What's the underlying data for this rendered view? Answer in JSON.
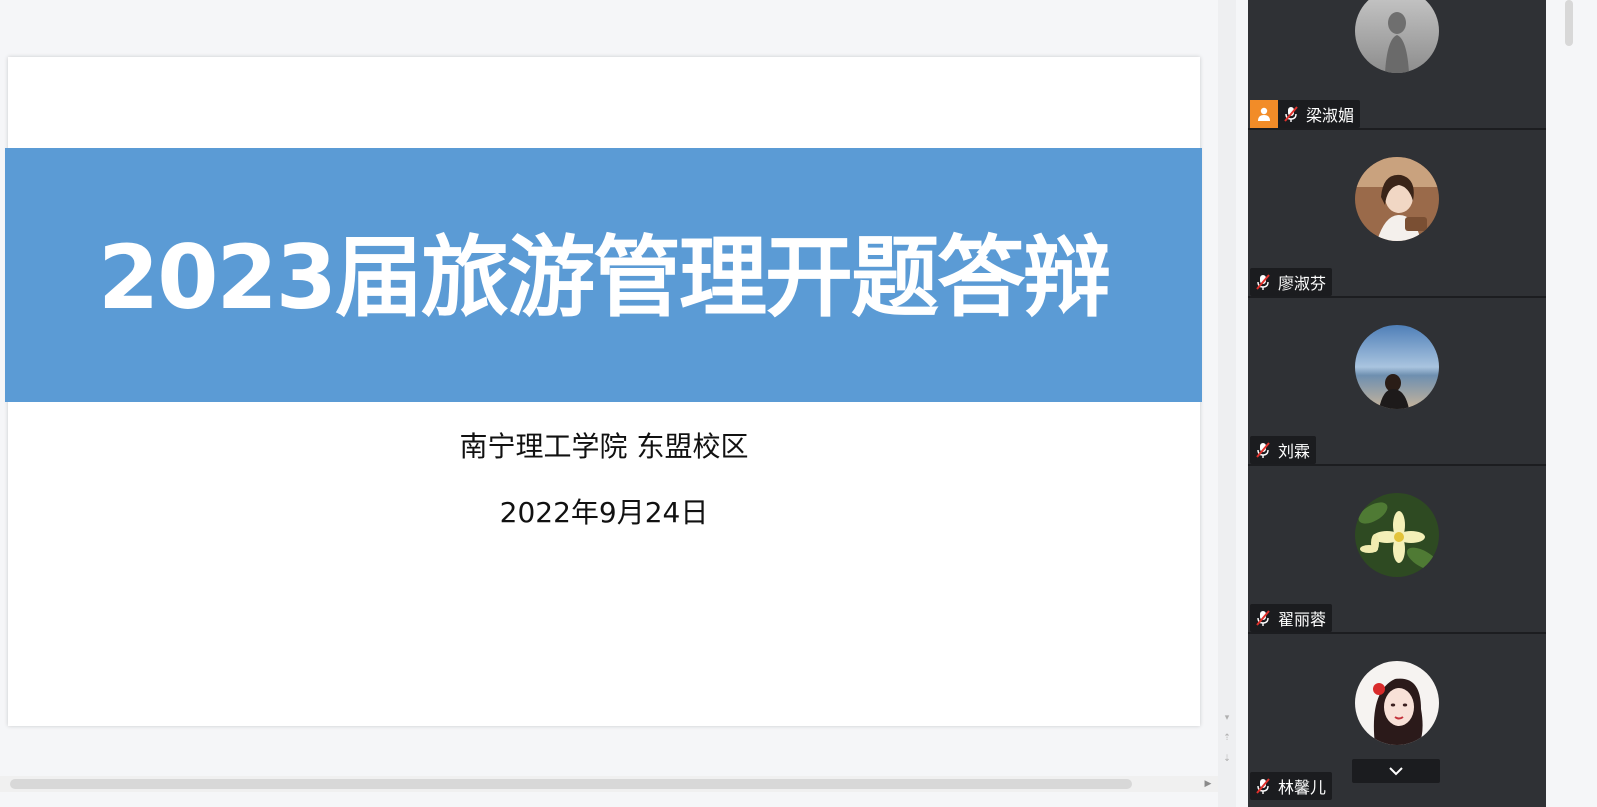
{
  "slide": {
    "title": "2023届旅游管理开题答辩",
    "subtitle": "南宁理工学院 东盟校区",
    "date": "2022年9月24日"
  },
  "colors": {
    "title_band": "#5b9bd5",
    "panel_bg": "#2f3135",
    "host_badge": "#f28c28",
    "mute_red": "#e0312c"
  },
  "participants": [
    {
      "name": "梁淑媚",
      "muted": true,
      "host": true,
      "avatar": "silhouette-avatar"
    },
    {
      "name": "廖淑芬",
      "muted": true,
      "host": false,
      "avatar": "portrait-avatar"
    },
    {
      "name": "刘霖",
      "muted": true,
      "host": false,
      "avatar": "beach-avatar"
    },
    {
      "name": "翟丽蓉",
      "muted": true,
      "host": false,
      "avatar": "flower-avatar"
    },
    {
      "name": "林馨儿",
      "muted": true,
      "host": false,
      "avatar": "illustrated-avatar"
    }
  ],
  "icons": {
    "mute": "mic-muted-icon",
    "host": "user-icon",
    "expand": "chevron-down-icon"
  }
}
